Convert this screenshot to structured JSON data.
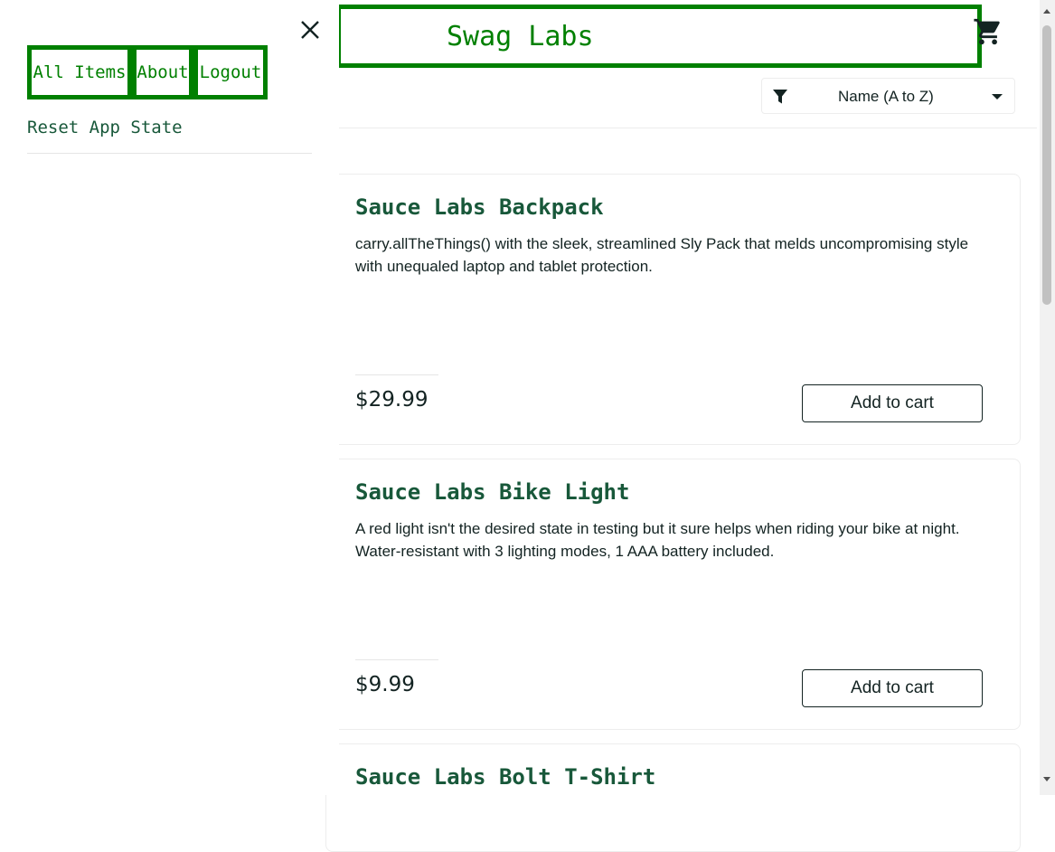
{
  "sidebar": {
    "close_label": "Close Menu",
    "items": [
      {
        "label": "All Items"
      },
      {
        "label": "About"
      },
      {
        "label": "Logout"
      }
    ],
    "reset_label": "Reset App State"
  },
  "header": {
    "title": "Swag Labs",
    "cart_icon": "cart-icon",
    "sort": {
      "selected": "Name (A to Z)",
      "filter_icon": "filter-icon",
      "caret_icon": "caret-down-icon"
    }
  },
  "products": [
    {
      "name": "Sauce Labs Backpack",
      "description": "carry.allTheThings() with the sleek, streamlined Sly Pack that melds uncompromising style with unequaled laptop and tablet protection.",
      "price": "$29.99",
      "button_label": "Add to cart"
    },
    {
      "name": "Sauce Labs Bike Light",
      "description": "A red light isn't the desired state in testing but it sure helps when riding your bike at night. Water-resistant with 3 lighting modes, 1 AAA battery included.",
      "price": "$9.99",
      "button_label": "Add to cart"
    },
    {
      "name": "Sauce Labs Bolt T-Shirt"
    }
  ],
  "colors": {
    "accent": "#008000",
    "item_name": "#18583a",
    "text": "#132322"
  }
}
